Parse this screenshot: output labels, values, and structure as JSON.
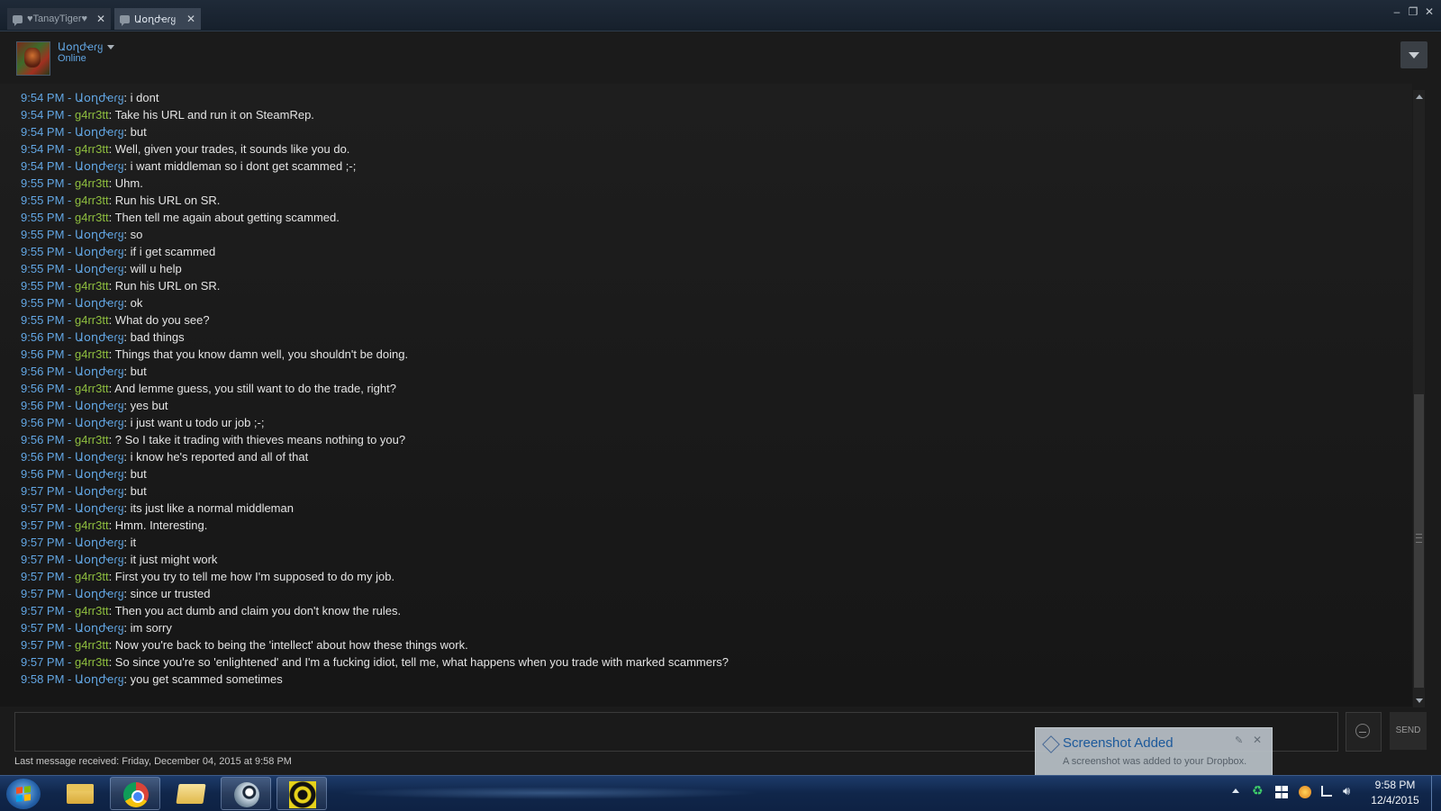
{
  "tabs": [
    {
      "label": "♥TanayTiger♥",
      "active": false
    },
    {
      "label": "Աօղժҽɾყ",
      "active": true
    }
  ],
  "tab_close_glyph": "✕",
  "window_controls": {
    "minimize": "–",
    "maximize": "❐",
    "close": "✕"
  },
  "header": {
    "username": "Աօղժҽɾყ",
    "status": "Online"
  },
  "chat": {
    "messages": [
      {
        "time": "9:54 PM",
        "name": "Աօղժҽɾყ",
        "text": "i dont",
        "sender": "wonder"
      },
      {
        "time": "9:54 PM",
        "name": "g4rr3tt",
        "text": "Take his URL and run it on SteamRep.",
        "sender": "g4"
      },
      {
        "time": "9:54 PM",
        "name": "Աօղժҽɾყ",
        "text": "but",
        "sender": "wonder"
      },
      {
        "time": "9:54 PM",
        "name": "g4rr3tt",
        "text": "Well, given your trades, it sounds like you do.",
        "sender": "g4"
      },
      {
        "time": "9:54 PM",
        "name": "Աօղժҽɾყ",
        "text": "i want middleman so i dont get scammed ;-;",
        "sender": "wonder"
      },
      {
        "time": "9:55 PM",
        "name": "g4rr3tt",
        "text": "Uhm.",
        "sender": "g4"
      },
      {
        "time": "9:55 PM",
        "name": "g4rr3tt",
        "text": "Run his URL on SR.",
        "sender": "g4"
      },
      {
        "time": "9:55 PM",
        "name": "g4rr3tt",
        "text": "Then tell me again about getting scammed.",
        "sender": "g4"
      },
      {
        "time": "9:55 PM",
        "name": "Աօղժҽɾყ",
        "text": "so",
        "sender": "wonder"
      },
      {
        "time": "9:55 PM",
        "name": "Աօղժҽɾყ",
        "text": "if i get scammed",
        "sender": "wonder"
      },
      {
        "time": "9:55 PM",
        "name": "Աօղժҽɾყ",
        "text": "will u help",
        "sender": "wonder"
      },
      {
        "time": "9:55 PM",
        "name": "g4rr3tt",
        "text": "Run his URL on SR.",
        "sender": "g4"
      },
      {
        "time": "9:55 PM",
        "name": "Աօղժҽɾყ",
        "text": "ok",
        "sender": "wonder"
      },
      {
        "time": "9:55 PM",
        "name": "g4rr3tt",
        "text": "What do you see?",
        "sender": "g4"
      },
      {
        "time": "9:56 PM",
        "name": "Աօղժҽɾყ",
        "text": "bad things",
        "sender": "wonder"
      },
      {
        "time": "9:56 PM",
        "name": "g4rr3tt",
        "text": "Things that you know damn well, you shouldn't be doing.",
        "sender": "g4"
      },
      {
        "time": "9:56 PM",
        "name": "Աօղժҽɾყ",
        "text": "but",
        "sender": "wonder"
      },
      {
        "time": "9:56 PM",
        "name": "g4rr3tt",
        "text": "And lemme guess, you still want to do the trade, right?",
        "sender": "g4"
      },
      {
        "time": "9:56 PM",
        "name": "Աօղժҽɾყ",
        "text": "yes but",
        "sender": "wonder"
      },
      {
        "time": "9:56 PM",
        "name": "Աօղժҽɾყ",
        "text": "i just want u todo ur job ;-;",
        "sender": "wonder"
      },
      {
        "time": "9:56 PM",
        "name": "g4rr3tt",
        "text": "? So I take it trading with thieves means nothing to you?",
        "sender": "g4"
      },
      {
        "time": "9:56 PM",
        "name": "Աօղժҽɾყ",
        "text": "i know he's reported and all of that",
        "sender": "wonder"
      },
      {
        "time": "9:56 PM",
        "name": "Աօղժҽɾყ",
        "text": "but",
        "sender": "wonder"
      },
      {
        "time": "9:57 PM",
        "name": "Աօղժҽɾყ",
        "text": "but",
        "sender": "wonder"
      },
      {
        "time": "9:57 PM",
        "name": "Աօղժҽɾყ",
        "text": "its just like a normal middleman",
        "sender": "wonder"
      },
      {
        "time": "9:57 PM",
        "name": "g4rr3tt",
        "text": "Hmm. Interesting.",
        "sender": "g4"
      },
      {
        "time": "9:57 PM",
        "name": "Աօղժҽɾყ",
        "text": "it",
        "sender": "wonder"
      },
      {
        "time": "9:57 PM",
        "name": "Աօղժҽɾყ",
        "text": "it just might work",
        "sender": "wonder"
      },
      {
        "time": "9:57 PM",
        "name": "g4rr3tt",
        "text": "First you try to tell me how I'm supposed to do my job.",
        "sender": "g4"
      },
      {
        "time": "9:57 PM",
        "name": "Աօղժҽɾყ",
        "text": "since ur trusted",
        "sender": "wonder"
      },
      {
        "time": "9:57 PM",
        "name": "g4rr3tt",
        "text": "Then you act dumb and claim you don't know the rules.",
        "sender": "g4"
      },
      {
        "time": "9:57 PM",
        "name": "Աօղժҽɾყ",
        "text": "im sorry",
        "sender": "wonder"
      },
      {
        "time": "9:57 PM",
        "name": "g4rr3tt",
        "text": "Now you're back to being the 'intellect' about how these things work.",
        "sender": "g4"
      },
      {
        "time": "9:57 PM",
        "name": "g4rr3tt",
        "text": "So since you're so 'enlightened' and I'm a fucking idiot, tell me, what happens when you trade with marked scammers?",
        "sender": "g4"
      },
      {
        "time": "9:58 PM",
        "name": "Աօղժҽɾყ",
        "text": "you get scammed sometimes",
        "sender": "wonder"
      }
    ]
  },
  "input": {
    "value": "",
    "send_label": "SEND"
  },
  "last_message": "Last message received: Friday, December 04, 2015 at 9:58 PM",
  "notification": {
    "title": "Screenshot Added",
    "body": "A screenshot was added to your Dropbox."
  },
  "taskbar": {
    "apps": [
      "explorer",
      "chrome",
      "folder",
      "steam",
      "game"
    ],
    "clock_time": "9:58 PM",
    "clock_date": "12/4/2015"
  },
  "colors": {
    "timestamp": "#62a6e3",
    "self_name": "#62a6e3",
    "friend_name": "#8fbf3f",
    "message_text": "#e4e4e4"
  }
}
